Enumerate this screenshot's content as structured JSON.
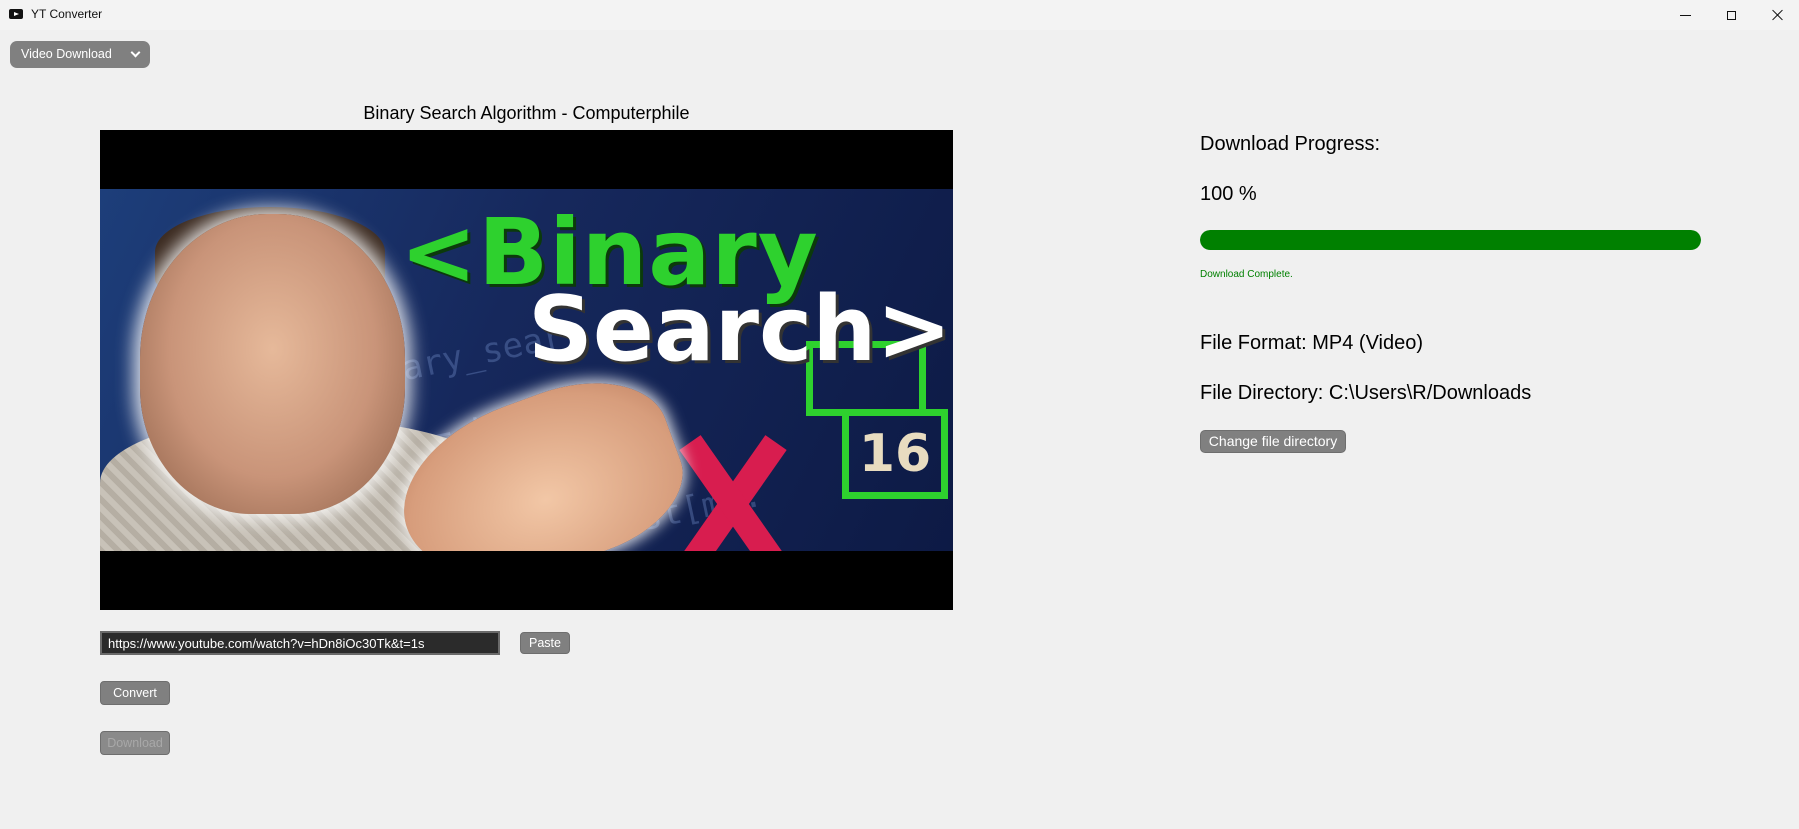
{
  "window": {
    "title": "YT Converter"
  },
  "mode_selector": {
    "value": "Video Download"
  },
  "video": {
    "title": "Binary Search Algorithm - Computerphile",
    "thumbnail_text": [
      "<Binary",
      "Search>",
      "16"
    ]
  },
  "url_input": {
    "value": "https://www.youtube.com/watch?v=hDn8iOc30Tk&t=1s"
  },
  "buttons": {
    "paste": "Paste",
    "convert": "Convert",
    "download": "Download",
    "change_directory": "Change file directory"
  },
  "progress": {
    "label": "Download Progress:",
    "value_text": "100 %",
    "fraction": 1.0,
    "status": "Download Complete.",
    "status_color": "#008000",
    "bar_color": "#008000"
  },
  "file": {
    "format": "File Format: MP4 (Video)",
    "directory": "File Directory: C:\\Users\\R/Downloads"
  },
  "icons": {
    "app": "youtube-icon",
    "minimize": "minimize-icon",
    "maximize": "maximize-icon",
    "close": "close-icon",
    "dropdown": "chevron-down-icon"
  }
}
